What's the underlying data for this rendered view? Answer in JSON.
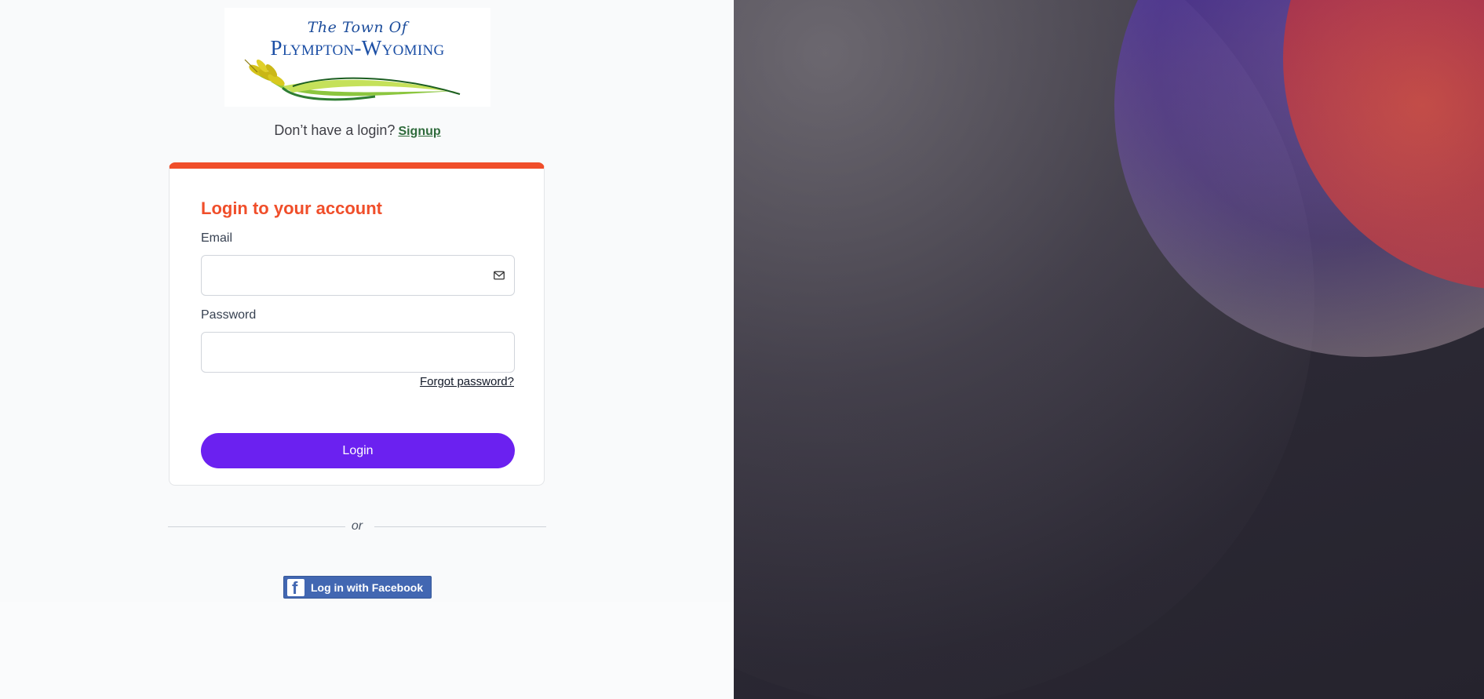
{
  "logo": {
    "line1": "The Town Of",
    "line2": "Plympton-Wyoming"
  },
  "signup": {
    "prompt": "Don’t have a login?",
    "link_label": "Signup",
    "link_color": "#2f6b3c"
  },
  "login_card": {
    "title": "Login to your account",
    "accent_color": "#f04e2a",
    "email": {
      "label": "Email",
      "value": "",
      "icon": "mail-icon"
    },
    "password": {
      "label": "Password",
      "value": ""
    },
    "forgot_label": "Forgot password?",
    "login_label": "Login",
    "button_color": "#6b21f0"
  },
  "divider": {
    "text": "or"
  },
  "facebook": {
    "label": "Log in with Facebook",
    "icon": "facebook-icon",
    "color": "#4267b2"
  }
}
